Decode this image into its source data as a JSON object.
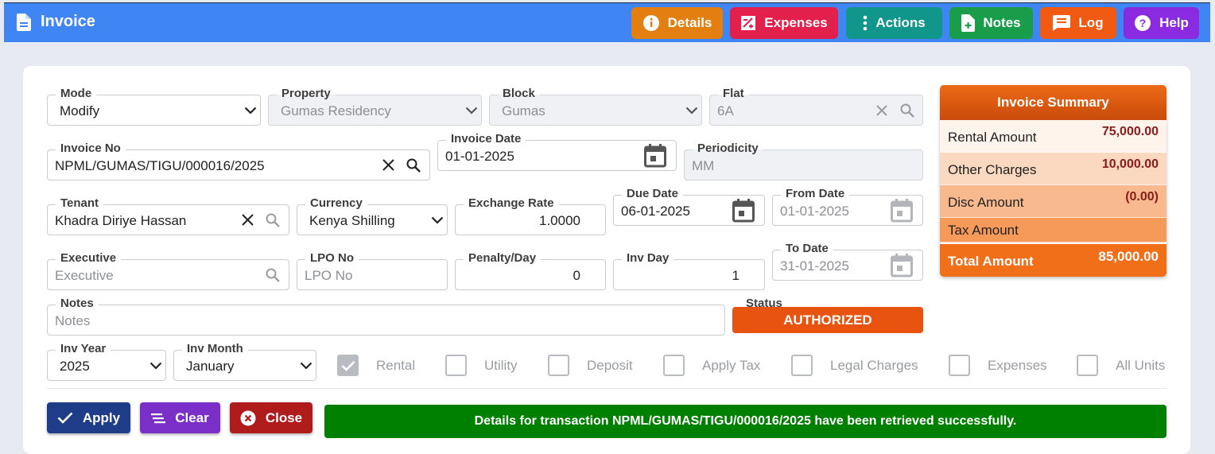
{
  "header": {
    "title": "Invoice",
    "buttons": [
      {
        "label": "Details",
        "icon": "info-icon",
        "color": "#e37f10"
      },
      {
        "label": "Expenses",
        "icon": "expense-icon",
        "color": "#e31f4c"
      },
      {
        "label": "Actions",
        "icon": "more-vertical-icon",
        "color": "#10968a"
      },
      {
        "label": "Notes",
        "icon": "note-add-icon",
        "color": "#1a9d4a"
      },
      {
        "label": "Log",
        "icon": "log-icon",
        "color": "#f05a12"
      },
      {
        "label": "Help",
        "icon": "help-icon",
        "color": "#8a2be2"
      }
    ]
  },
  "form": {
    "mode": {
      "label": "Mode",
      "value": "Modify"
    },
    "property": {
      "label": "Property",
      "value": "Gumas Residency"
    },
    "block": {
      "label": "Block",
      "value": "Gumas"
    },
    "flat": {
      "label": "Flat",
      "value": "6A"
    },
    "invoice_no": {
      "label": "Invoice No",
      "value": "NPML/GUMAS/TIGU/000016/2025"
    },
    "invoice_date": {
      "label": "Invoice Date",
      "value": "01-01-2025"
    },
    "periodicity": {
      "label": "Periodicity",
      "value": "MM"
    },
    "tenant": {
      "label": "Tenant",
      "value": "Khadra Diriye Hassan"
    },
    "currency": {
      "label": "Currency",
      "value": "Kenya Shilling"
    },
    "exchange_rate": {
      "label": "Exchange Rate",
      "value": "1.0000"
    },
    "due_date": {
      "label": "Due Date",
      "value": "06-01-2025"
    },
    "from_date": {
      "label": "From Date",
      "value": "01-01-2025"
    },
    "executive": {
      "label": "Executive",
      "placeholder": "Executive"
    },
    "lpo_no": {
      "label": "LPO No",
      "placeholder": "LPO No"
    },
    "penalty_day": {
      "label": "Penalty/Day",
      "value": "0"
    },
    "inv_day": {
      "label": "Inv Day",
      "value": "1"
    },
    "to_date": {
      "label": "To Date",
      "value": "31-01-2025"
    },
    "notes": {
      "label": "Notes",
      "placeholder": "Notes"
    },
    "status": {
      "label": "Status",
      "value": "AUTHORIZED"
    },
    "inv_year": {
      "label": "Inv Year",
      "value": "2025"
    },
    "inv_month": {
      "label": "Inv Month",
      "value": "January"
    }
  },
  "checkboxes": [
    {
      "label": "Rental",
      "checked": true
    },
    {
      "label": "Utility",
      "checked": false
    },
    {
      "label": "Deposit",
      "checked": false
    },
    {
      "label": "Apply Tax",
      "checked": false
    },
    {
      "label": "Legal Charges",
      "checked": false
    },
    {
      "label": "Expenses",
      "checked": false
    },
    {
      "label": "All Units",
      "checked": false
    }
  ],
  "summary": {
    "title": "Invoice Summary",
    "rows": [
      {
        "label": "Rental Amount",
        "value": "75,000.00"
      },
      {
        "label": "Other Charges",
        "value": "10,000.00"
      },
      {
        "label": "Disc Amount",
        "value": "(0.00)"
      },
      {
        "label": "Tax Amount",
        "value": ""
      }
    ],
    "total": {
      "label": "Total Amount",
      "value": "85,000.00"
    }
  },
  "actions": {
    "apply": "Apply",
    "clear": "Clear",
    "close": "Close"
  },
  "message": "Details for transaction NPML/GUMAS/TIGU/000016/2025 have been retrieved successfully."
}
